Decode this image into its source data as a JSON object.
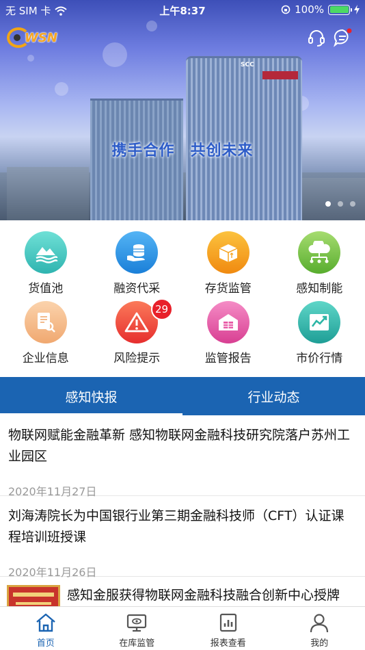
{
  "status_bar": {
    "carrier": "无 SIM 卡",
    "time": "上午8:37",
    "battery": "100%"
  },
  "header": {
    "logo_text": "WSN",
    "slogan": "携手合作　共创未来",
    "icons": [
      "headset-icon",
      "message-icon"
    ]
  },
  "banner": {
    "carousel_index": 1,
    "carousel_count": 3
  },
  "grid": {
    "items": [
      {
        "label": "货值池",
        "icon": "landscape-icon",
        "color": "#3ec6c0"
      },
      {
        "label": "融资代采",
        "icon": "coin-stack-icon",
        "color": "#2a8fe0"
      },
      {
        "label": "存货监管",
        "icon": "box-icon",
        "color": "#f6a21c"
      },
      {
        "label": "感知制能",
        "icon": "cloud-network-icon",
        "color": "#7cc24a"
      },
      {
        "label": "企业信息",
        "icon": "document-search-icon",
        "color": "#f2b27c"
      },
      {
        "label": "风险提示",
        "icon": "warning-icon",
        "color": "#f0473a",
        "badge": "29"
      },
      {
        "label": "监管报告",
        "icon": "warehouse-icon",
        "color": "#e85aa6"
      },
      {
        "label": "市价行情",
        "icon": "trend-chart-icon",
        "color": "#2cb6a6"
      }
    ]
  },
  "tabs": [
    {
      "label": "感知快报",
      "active": true
    },
    {
      "label": "行业动态",
      "active": false
    }
  ],
  "news": [
    {
      "title": "物联网赋能金融革新 感知物联网金融科技研究院落户苏州工业园区",
      "date": "2020年11月27日"
    },
    {
      "title": "刘海涛院长为中国银行业第三期金融科技师（CFT）认证课程培训班授课",
      "date": "2020年11月26日"
    },
    {
      "title": "感知金服获得物联网金融科技融合创新中心授牌"
    }
  ],
  "bottom_nav": [
    {
      "label": "首页",
      "icon": "home-icon",
      "active": true
    },
    {
      "label": "在库监管",
      "icon": "monitor-icon",
      "active": false
    },
    {
      "label": "报表查看",
      "icon": "report-icon",
      "active": false
    },
    {
      "label": "我的",
      "icon": "person-icon",
      "active": false
    }
  ],
  "colors": {
    "primary": "#1b64b2",
    "badge": "#e8202a"
  }
}
